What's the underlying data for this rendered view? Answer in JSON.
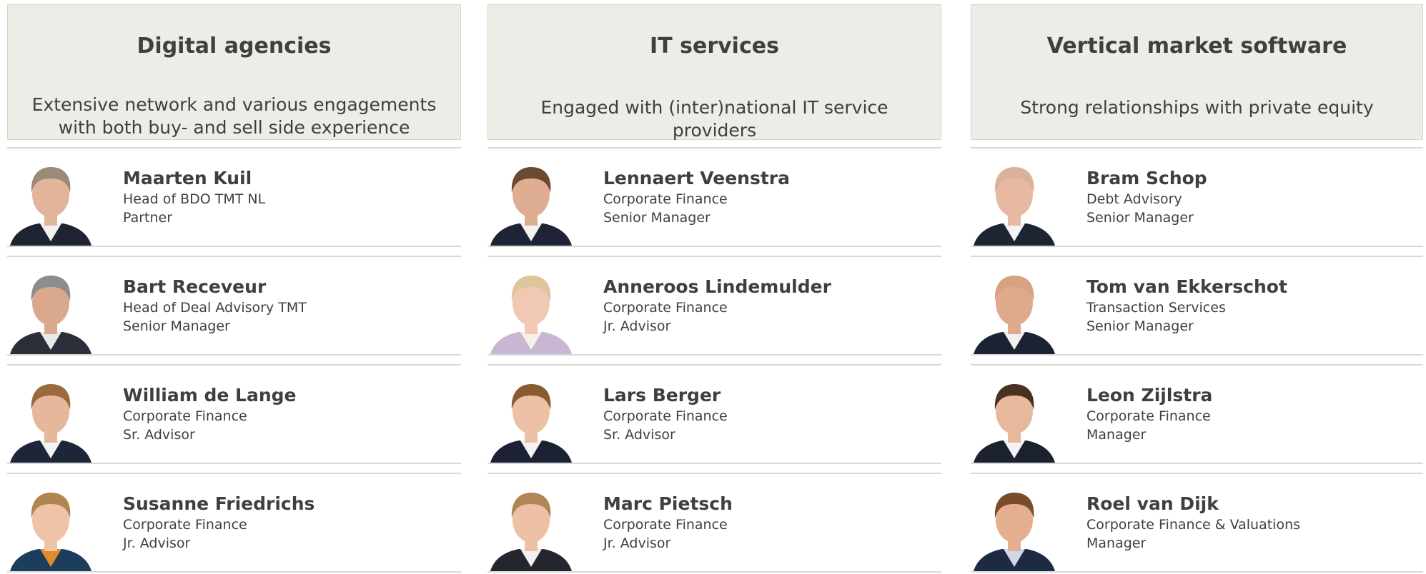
{
  "columns": [
    {
      "title": "Digital agencies",
      "subtitle": "Extensive network and various engagements with both buy- and sell side experience",
      "people": [
        {
          "name": "Maarten Kuil",
          "line1": "Head of BDO TMT NL",
          "line2": "Partner",
          "hair": "#9a8a78",
          "skin": "#e2b49a",
          "suit": "#1f2433",
          "shirt": "#f2f2f2"
        },
        {
          "name": "Bart Receveur",
          "line1": "Head of Deal Advisory TMT",
          "line2": "Senior Manager",
          "hair": "#8d8d8d",
          "skin": "#d9a88d",
          "suit": "#2b2f3a",
          "shirt": "#e9e9e9"
        },
        {
          "name": "William de Lange",
          "line1": "Corporate Finance",
          "line2": "Sr. Advisor",
          "hair": "#9b6a3c",
          "skin": "#e6b79b",
          "suit": "#1d2638",
          "shirt": "#f3f3f3"
        },
        {
          "name": "Susanne Friedrichs",
          "line1": "Corporate Finance",
          "line2": "Jr. Advisor",
          "hair": "#b0854f",
          "skin": "#eec3a8",
          "suit": "#1c3d5c",
          "shirt": "#e28b2c"
        }
      ]
    },
    {
      "title": "IT services",
      "subtitle": "Engaged with (inter)national IT service providers",
      "people": [
        {
          "name": "Lennaert Veenstra",
          "line1": "Corporate Finance",
          "line2": "Senior Manager",
          "hair": "#6b4a2f",
          "skin": "#dfae92",
          "suit": "#1e2435",
          "shirt": "#f2f2f2"
        },
        {
          "name": "Anneroos Lindemulder",
          "line1": "Corporate Finance",
          "line2": "Jr. Advisor",
          "hair": "#dcc69a",
          "skin": "#f0c8b3",
          "suit": "#c9b6d2",
          "shirt": "#f4f1ea"
        },
        {
          "name": "Lars Berger",
          "line1": "Corporate Finance",
          "line2": "Sr. Advisor",
          "hair": "#8a5a30",
          "skin": "#ecc1a6",
          "suit": "#1c2233",
          "shirt": "#f3f3f3"
        },
        {
          "name": "Marc Pietsch",
          "line1": "Corporate Finance",
          "line2": "Jr. Advisor",
          "hair": "#b18555",
          "skin": "#eec1a4",
          "suit": "#23262e",
          "shirt": "#f0f0f0"
        }
      ]
    },
    {
      "title": "Vertical market software",
      "subtitle": "Strong relationships with private equity",
      "people": [
        {
          "name": "Bram Schop",
          "line1": "Debt Advisory",
          "line2": "Senior Manager",
          "hair": "#d9b29a",
          "skin": "#e6b9a0",
          "suit": "#1f2433",
          "shirt": "#f3f3f3"
        },
        {
          "name": "Tom van Ekkerschot",
          "line1": "Transaction Services",
          "line2": "Senior Manager",
          "hair": "#d7a183",
          "skin": "#dfa98c",
          "suit": "#1a2234",
          "shirt": "#f0f0f0"
        },
        {
          "name": "Leon Zijlstra",
          "line1": "Corporate Finance",
          "line2": "Manager",
          "hair": "#4a3020",
          "skin": "#e7b89b",
          "suit": "#1b2130",
          "shirt": "#f3f3f3"
        },
        {
          "name": "Roel van Dijk",
          "line1": "Corporate Finance & Valuations",
          "line2": "Manager",
          "hair": "#7a4c2a",
          "skin": "#e3af90",
          "suit": "#1d2a44",
          "shirt": "#cfd9e6"
        }
      ]
    }
  ]
}
